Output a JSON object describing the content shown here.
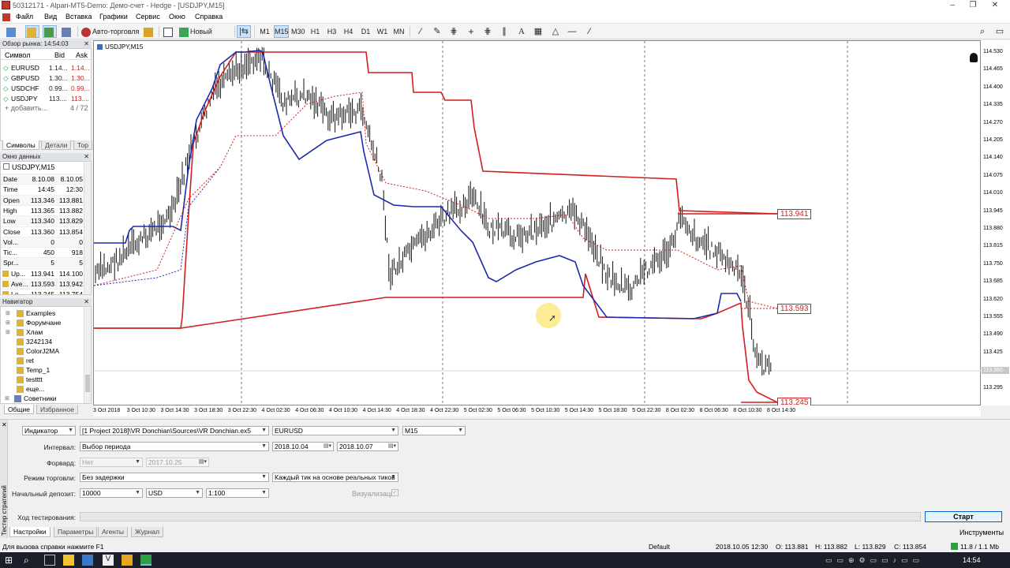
{
  "window": {
    "title": "50312171 - Alpari-MT5-Demo: Демо-счет - Hedge - [USDJPY,M15]"
  },
  "menu": [
    "Файл",
    "Вид",
    "Вставка",
    "Графики",
    "Сервис",
    "Окно",
    "Справка"
  ],
  "toolbar": {
    "autotrade_label": "Авто-торговля",
    "new_order_label": "Новый ордер",
    "timeframes": [
      "M1",
      "M15",
      "M30",
      "H1",
      "H3",
      "H4",
      "D1",
      "W1",
      "MN"
    ],
    "active_timeframe": "M15"
  },
  "market_watch": {
    "title": "Обзор рынка: 14:54:03",
    "columns": [
      "Символ",
      "Bid",
      "Ask"
    ],
    "rows": [
      {
        "symbol": "EURUSD",
        "bid": "1.14...",
        "ask": "1.14..."
      },
      {
        "symbol": "GBPUSD",
        "bid": "1.30...",
        "ask": "1.30..."
      },
      {
        "symbol": "USDCHF",
        "bid": "0.99...",
        "ask": "0.99..."
      },
      {
        "symbol": "USDJPY",
        "bid": "113....",
        "ask": "113...."
      }
    ],
    "add_label": "добавить...",
    "count": "4 / 72",
    "tabs": [
      "Символы",
      "Детали",
      "Тор"
    ]
  },
  "data_window": {
    "title": "Окно данных",
    "symbol": "USDJPY,M15",
    "rows": [
      {
        "label": "Date",
        "v1": "8.10.08",
        "v2": "8.10.05"
      },
      {
        "label": "Time",
        "v1": "14:45",
        "v2": "12:30"
      },
      {
        "label": "Open",
        "v1": "113.346",
        "v2": "113.881"
      },
      {
        "label": "High",
        "v1": "113.365",
        "v2": "113.882"
      },
      {
        "label": "Low",
        "v1": "113.340",
        "v2": "113.829"
      },
      {
        "label": "Close",
        "v1": "113.360",
        "v2": "113.854"
      },
      {
        "label": "Vol...",
        "v1": "0",
        "v2": "0"
      },
      {
        "label": "Tic...",
        "v1": "450",
        "v2": "918"
      },
      {
        "label": "Spr...",
        "v1": "5",
        "v2": "5"
      },
      {
        "label": "Up...",
        "v1": "113.941",
        "v2": "114.100"
      },
      {
        "label": "Ave...",
        "v1": "113.593",
        "v2": "113.942"
      },
      {
        "label": "Lo...",
        "v1": "113.245",
        "v2": "113.754"
      }
    ]
  },
  "navigator": {
    "title": "Навигатор",
    "items": [
      "Examples",
      "Форумчане",
      "Хлам",
      "3242134",
      "ColorJ2MA",
      "ret",
      "Temp_1",
      "testttt",
      "еще...",
      "Советники"
    ],
    "tabs": [
      "Общие",
      "Избранное"
    ]
  },
  "chart": {
    "symbol_label": "USDJPY,M15",
    "price_ticks": [
      "114.530",
      "114.465",
      "114.400",
      "114.335",
      "114.270",
      "114.205",
      "114.140",
      "114.075",
      "114.010",
      "113.945",
      "113.880",
      "113.815",
      "113.750",
      "113.685",
      "113.620",
      "113.555",
      "113.490",
      "113.425",
      "113.360",
      "113.295"
    ],
    "current_price": "113.360",
    "time_ticks": [
      "3 Oct 2018",
      "3 Oct 10:30",
      "3 Oct 14:30",
      "3 Oct 18:30",
      "3 Oct 22:30",
      "4 Oct 02:30",
      "4 Oct 06:30",
      "4 Oct 10:30",
      "4 Oct 14:30",
      "4 Oct 18:30",
      "4 Oct 22:30",
      "5 Oct 02:30",
      "5 Oct 06:30",
      "5 Oct 10:30",
      "5 Oct 14:30",
      "5 Oct 18:30",
      "5 Oct 22:30",
      "8 Oct 02:30",
      "8 Oct 06:30",
      "8 Oct 10:30",
      "8 Oct 14:30"
    ],
    "labels": {
      "upper": "113.941",
      "middle": "113.593",
      "lower": "113.245"
    },
    "colors": {
      "upper": "#d21f1f",
      "lower": "#1c2bb0",
      "middle": "#d21f1f"
    }
  },
  "tester": {
    "side_label": "Тестер стратегий",
    "mode": "Индикатор",
    "program": "[1 Project 2018]\\VR Donchian\\Sources\\VR Donchian.ex5",
    "symbol": "EURUSD",
    "timeframe": "M15",
    "interval_label": "Интервал:",
    "interval": "Выбор периода",
    "date_from": "2018.10.04",
    "date_to": "2018.10.07",
    "forward_label": "Форвард:",
    "forward": "Нет",
    "forward_date": "2017.10.25",
    "trade_mode_label": "Режим торговли:",
    "trade_mode": "Без задержки",
    "tick_mode": "Каждый тик на основе реальных тиков",
    "deposit_label": "Начальный депозит:",
    "deposit": "10000",
    "currency": "USD",
    "leverage": "1:100",
    "visualize_label": "Визуализация",
    "progress_label": "Ход тестирования:",
    "start_label": "Старт",
    "tabs": [
      "Настройки",
      "Параметры",
      "Агенты",
      "Журнал"
    ],
    "tools_label": "Инструменты"
  },
  "status": {
    "help": "Для вызова справки нажмите F1",
    "profile": "Default",
    "datetime": "2018.10.05 12:30",
    "o": "O: 113.881",
    "h": "H: 113.882",
    "l": "L: 113.829",
    "c": "C: 113.854",
    "traffic": "11.8 / 1.1 Mb"
  },
  "taskbar": {
    "clock": "14:54"
  }
}
